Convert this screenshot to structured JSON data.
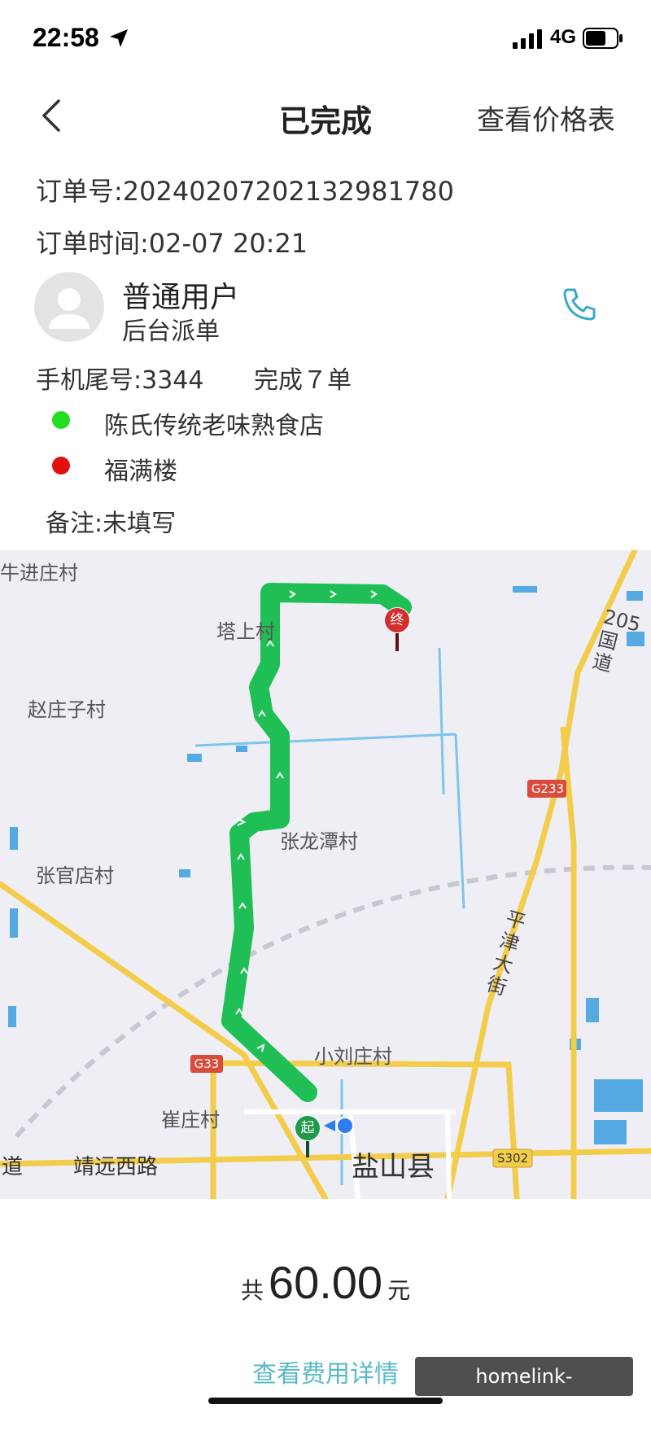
{
  "status": {
    "time": "22:58",
    "network": "4G"
  },
  "nav": {
    "title": "已完成",
    "price_table": "查看价格表"
  },
  "order": {
    "number_line": "订单号:20240207202132981780",
    "time_line": "订单时间:02-07 20:21"
  },
  "user": {
    "name": "普通用户",
    "source": "后台派单",
    "phone_tail": "手机尾号:3344",
    "completed": "完成７单"
  },
  "route": {
    "start": "陈氏传统老味熟食店",
    "end": "福满楼",
    "start_color": "#22dd22",
    "end_color": "#e01010"
  },
  "remark": "备注:未填写",
  "map": {
    "labels": {
      "niujin": "牛进庄村",
      "tashang": "塔上村",
      "zhaozhuangzi": "赵庄子村",
      "zhanglongtan": "张龙潭村",
      "zhangguandian": "张官店村",
      "xiaoliuzhuang": "小刘庄村",
      "cuizhuang": "崔庄村",
      "jingyuan": "靖远西路",
      "dao": "道",
      "yanshan": "盐山县",
      "guodao205": "205国道",
      "pingjin": "平津大街",
      "g233": "G233",
      "g33": "G33",
      "s302": "S302"
    },
    "start_marker": "起",
    "end_marker": "终",
    "route_color": "#1fbf55"
  },
  "fare": {
    "prefix": "共",
    "amount": "60.00",
    "suffix": "元",
    "detail_link": "查看费用详情"
  },
  "watermark": "homelink-boao.com.cn"
}
